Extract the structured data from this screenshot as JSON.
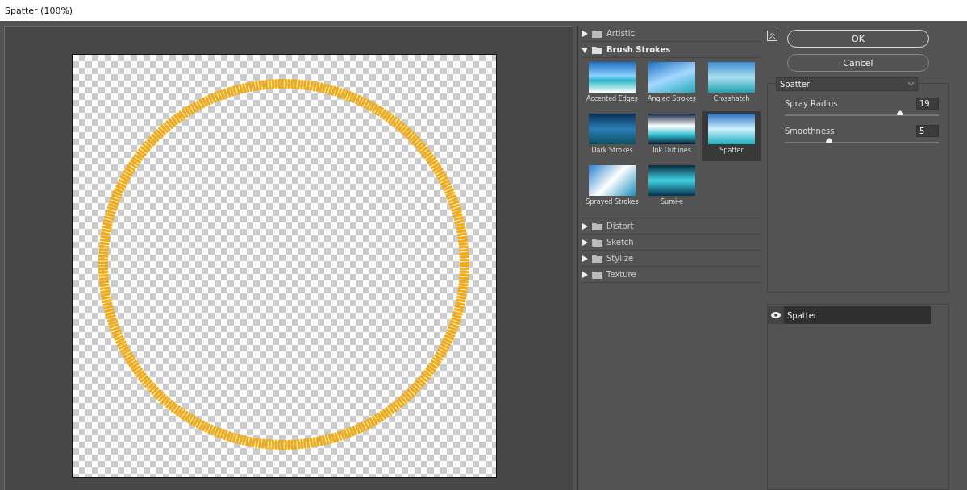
{
  "window": {
    "title": "Spatter (100%)"
  },
  "categories": [
    {
      "name": "Artistic",
      "expanded": false
    },
    {
      "name": "Brush Strokes",
      "expanded": true,
      "filters": [
        {
          "name": "Accented Edges",
          "selected": false
        },
        {
          "name": "Angled Strokes",
          "selected": false
        },
        {
          "name": "Crosshatch",
          "selected": false
        },
        {
          "name": "Dark Strokes",
          "selected": false
        },
        {
          "name": "Ink Outlines",
          "selected": false
        },
        {
          "name": "Spatter",
          "selected": true
        },
        {
          "name": "Sprayed Strokes",
          "selected": false
        },
        {
          "name": "Sumi-e",
          "selected": false
        }
      ]
    },
    {
      "name": "Distort",
      "expanded": false
    },
    {
      "name": "Sketch",
      "expanded": false
    },
    {
      "name": "Stylize",
      "expanded": false
    },
    {
      "name": "Texture",
      "expanded": false
    }
  ],
  "buttons": {
    "ok": "OK",
    "cancel": "Cancel"
  },
  "filter_select": {
    "value": "Spatter"
  },
  "settings": [
    {
      "label": "Spray Radius",
      "value": "19",
      "level": 0.75
    },
    {
      "label": "Smoothness",
      "value": "5",
      "level": 0.29
    }
  ],
  "layers": [
    {
      "name": "Spatter",
      "visible": true
    }
  ]
}
